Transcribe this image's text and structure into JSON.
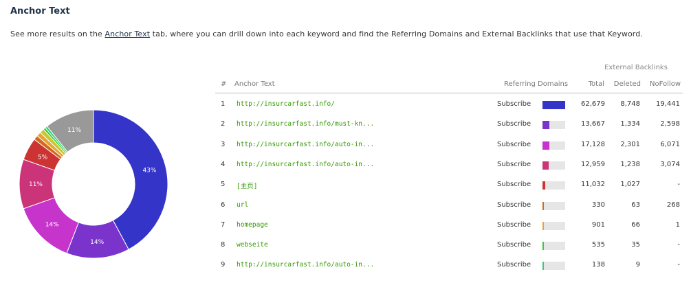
{
  "section": {
    "title": "Anchor Text",
    "desc_before": "See more results on the ",
    "desc_link": "Anchor Text",
    "desc_after": " tab, where you can drill down into each keyword and find the Referring Domains and External Backlinks that use that Keyword."
  },
  "chart_data": {
    "type": "pie",
    "variant": "donut",
    "slices": [
      {
        "value": 43,
        "label": "43%",
        "color": "#3434c8"
      },
      {
        "value": 14,
        "label": "14%",
        "color": "#7a34cc"
      },
      {
        "value": 14,
        "label": "14%",
        "color": "#c634cc"
      },
      {
        "value": 11,
        "label": "11%",
        "color": "#cc347a"
      },
      {
        "value": 5,
        "label": "5%",
        "color": "#cc3434"
      },
      {
        "value": 1,
        "label": "",
        "color": "#d2691e"
      },
      {
        "value": 1,
        "label": "",
        "color": "#e6a532"
      },
      {
        "value": 1,
        "label": "",
        "color": "#c8c832"
      },
      {
        "value": 0.5,
        "label": "",
        "color": "#34cc34"
      },
      {
        "value": 0.5,
        "label": "",
        "color": "#34cc7a"
      },
      {
        "value": 11,
        "label": "11%",
        "color": "#999999"
      }
    ]
  },
  "table": {
    "group_header": "External Backlinks",
    "headers": {
      "num": "#",
      "anchor": "Anchor Text",
      "ref": "Referring Domains",
      "total": "Total",
      "deleted": "Deleted",
      "nofollow": "NoFollow"
    },
    "rows": [
      {
        "num": "1",
        "anchor": "http://insurcarfast.info/",
        "ref": "Subscribe",
        "fraction": 1.0,
        "color": "#3434c8",
        "total": "62,679",
        "deleted": "8,748",
        "nofollow": "19,441"
      },
      {
        "num": "2",
        "anchor": "http://insurcarfast.info/must-kn...",
        "ref": "Subscribe",
        "fraction": 0.3,
        "color": "#7a34cc",
        "total": "13,667",
        "deleted": "1,334",
        "nofollow": "2,598"
      },
      {
        "num": "3",
        "anchor": "http://insurcarfast.info/auto-in...",
        "ref": "Subscribe",
        "fraction": 0.3,
        "color": "#c634cc",
        "total": "17,128",
        "deleted": "2,301",
        "nofollow": "6,071"
      },
      {
        "num": "4",
        "anchor": "http://insurcarfast.info/auto-in...",
        "ref": "Subscribe",
        "fraction": 0.27,
        "color": "#cc347a",
        "total": "12,959",
        "deleted": "1,238",
        "nofollow": "3,074"
      },
      {
        "num": "5",
        "anchor": "[主页]",
        "ref": "Subscribe",
        "fraction": 0.12,
        "color": "#cc3434",
        "total": "11,032",
        "deleted": "1,027",
        "nofollow": "-"
      },
      {
        "num": "6",
        "anchor": "url",
        "ref": "Subscribe",
        "fraction": 0.03,
        "color": "#d2691e",
        "total": "330",
        "deleted": "63",
        "nofollow": "268"
      },
      {
        "num": "7",
        "anchor": "homepage",
        "ref": "Subscribe",
        "fraction": 0.03,
        "color": "#e6a532",
        "total": "901",
        "deleted": "66",
        "nofollow": "1"
      },
      {
        "num": "8",
        "anchor": "webseite",
        "ref": "Subscribe",
        "fraction": 0.03,
        "color": "#34cc34",
        "total": "535",
        "deleted": "35",
        "nofollow": "-"
      },
      {
        "num": "9",
        "anchor": "http://insurcarfast.info/auto-in...",
        "ref": "Subscribe",
        "fraction": 0.03,
        "color": "#34cc7a",
        "total": "138",
        "deleted": "9",
        "nofollow": "-"
      }
    ]
  }
}
